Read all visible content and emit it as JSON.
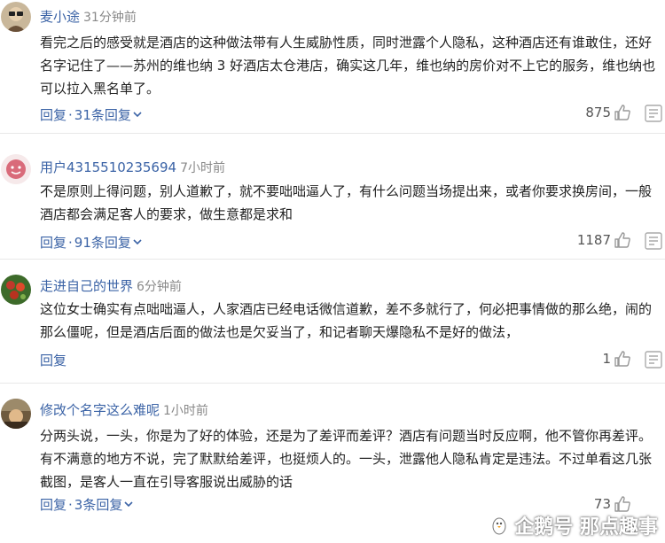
{
  "comments": [
    {
      "user": "麦小途",
      "time": "31分钟前",
      "text": "看完之后的感受就是酒店的这种做法带有人生威胁性质，同时泄露个人隐私，这种酒店还有谁敢住，还好名字记住了——苏州的维也纳 3 好酒店太仓港店，确实这几年，维也纳的房价对不上它的服务，维也纳也可以拉入黑名单了。",
      "reply_label": "回复",
      "replies_label": "31条回复",
      "likes": "875"
    },
    {
      "user": "用户4315510235694",
      "time": "7小时前",
      "text": "不是原则上得问题，别人道歉了，就不要咄咄逼人了，有什么问题当场提出来，或者你要求换房间，一般酒店都会满足客人的要求，做生意都是求和",
      "reply_label": "回复",
      "replies_label": "91条回复",
      "likes": "1187"
    },
    {
      "user": "走进自己的世界",
      "time": "6分钟前",
      "text": "这位女士确实有点咄咄逼人，人家酒店已经电话微信道歉，差不多就行了，何必把事情做的那么绝，闹的那么僵呢，但是酒店后面的做法也是欠妥当了，和记者聊天爆隐私不是好的做法，",
      "reply_label": "回复",
      "likes": "1"
    },
    {
      "user": "修改个名字这么难呢",
      "time": "1小时前",
      "text": "分两头说，一头，你是为了好的体验，还是为了差评而差评？酒店有问题当时反应啊，他不管你再差评。有不满意的地方不说，完了默默给差评，也挺烦人的。一头，泄露他人隐私肯定是违法。不过单看这几张截图，是客人一直在引导客服说出威胁的话",
      "reply_label": "回复",
      "replies_label": "3条回复",
      "likes": "73"
    }
  ],
  "watermark": "企鹅号 那点趣事",
  "icons": {
    "like": "thumbs-up-icon",
    "report": "report-icon",
    "expand": "chevron-down-icon",
    "watermark": "penguin-logo-icon"
  },
  "colors": {
    "link": "#3b63a6",
    "text": "#222222",
    "meta": "#888888"
  }
}
